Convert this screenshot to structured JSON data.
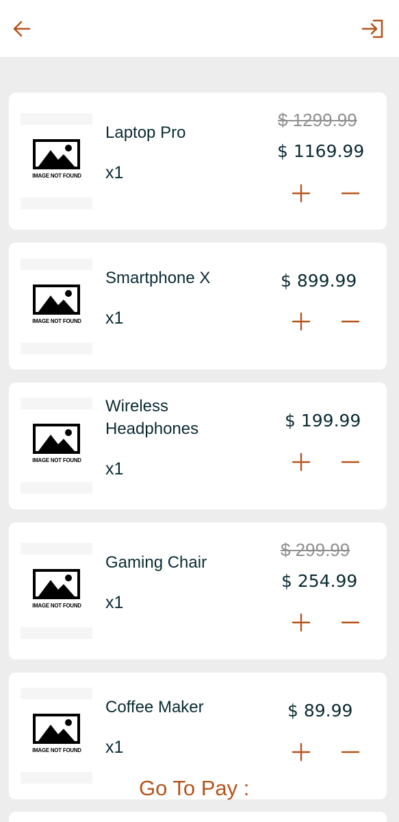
{
  "header": {
    "back_icon": "arrow-left-icon",
    "logout_icon": "sign-in-icon",
    "accent_color": "#b4541c"
  },
  "placeholder_image_text": "IMAGE NOT FOUND",
  "cart": {
    "items": [
      {
        "name": "Laptop Pro",
        "quantity": "x1",
        "original_price": "$ 1299.99",
        "price": "$ 1169.99"
      },
      {
        "name": "Smartphone X",
        "quantity": "x1",
        "original_price": "",
        "price": "$ 899.99"
      },
      {
        "name": "Wireless Headphones",
        "quantity": "x1",
        "original_price": "",
        "price": "$ 199.99"
      },
      {
        "name": "Gaming Chair",
        "quantity": "x1",
        "original_price": "$ 299.99",
        "price": "$ 254.99"
      },
      {
        "name": "Coffee Maker",
        "quantity": "x1",
        "original_price": "",
        "price": "$ 89.99"
      }
    ]
  },
  "footer": {
    "pay_label": "Go To Pay :"
  }
}
